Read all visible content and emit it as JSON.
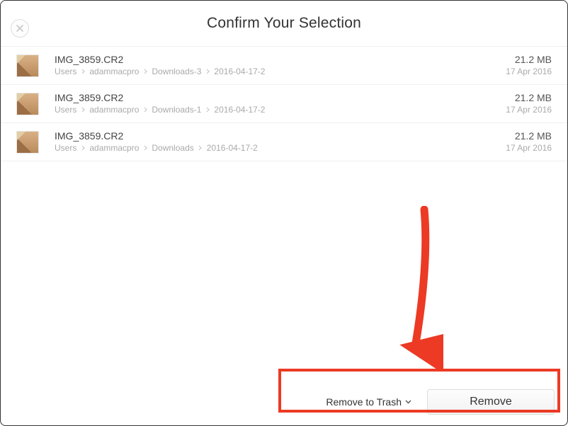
{
  "header": {
    "title": "Confirm Your Selection"
  },
  "files": [
    {
      "name": "IMG_3859.CR2",
      "path": [
        "Users",
        "adammacpro",
        "Downloads-3",
        "2016-04-17-2"
      ],
      "size": "21.2 MB",
      "date": "17 Apr 2016"
    },
    {
      "name": "IMG_3859.CR2",
      "path": [
        "Users",
        "adammacpro",
        "Downloads-1",
        "2016-04-17-2"
      ],
      "size": "21.2 MB",
      "date": "17 Apr 2016"
    },
    {
      "name": "IMG_3859.CR2",
      "path": [
        "Users",
        "adammacpro",
        "Downloads",
        "2016-04-17-2"
      ],
      "size": "21.2 MB",
      "date": "17 Apr 2016"
    }
  ],
  "footer": {
    "trash_option": "Remove to Trash",
    "remove_label": "Remove"
  },
  "annotation": {
    "arrow_color": "#ec3a24",
    "box_color": "#ec3a24"
  }
}
